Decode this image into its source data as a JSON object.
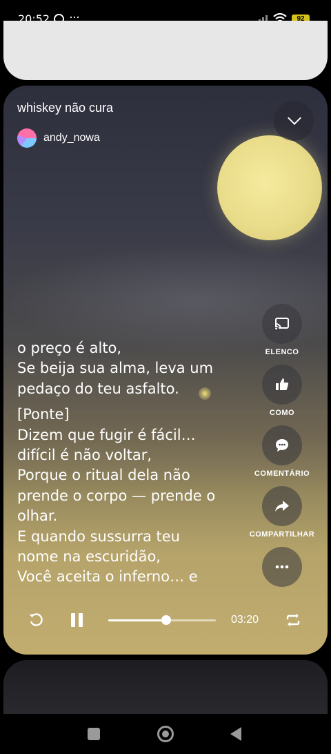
{
  "status_bar": {
    "time": "20:52",
    "battery": "92",
    "icons": [
      "whatsapp-icon",
      "more-dots-icon",
      "signal-icon",
      "wifi-icon",
      "battery-icon"
    ]
  },
  "track": {
    "title": "whiskey não cura",
    "author": "andy_nowa"
  },
  "lyrics": [
    "o preço é alto,",
    "Se beija sua alma, leva um",
    "pedaço do teu asfalto.",
    "[Ponte]",
    "Dizem que fugir é fácil…",
    "difícil é não voltar,",
    "Porque o ritual dela não",
    "prende o corpo — prende o",
    "olhar.",
    "E quando sussurra teu",
    "nome na escuridão,",
    "Você aceita o inferno… e"
  ],
  "actions": {
    "cast": "ELENCO",
    "like": "COMO",
    "comment": "COMENTÁRIO",
    "share": "COMPARTILHAR"
  },
  "player": {
    "duration": "03:20",
    "progress": 0.54
  },
  "colors": {
    "accent": "#ffffff",
    "moon": "#efe394",
    "card_bottom": "#c2ad6f"
  }
}
